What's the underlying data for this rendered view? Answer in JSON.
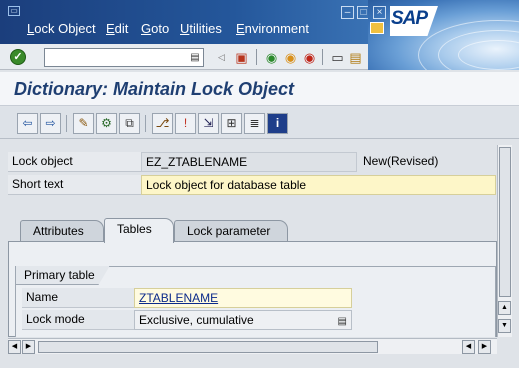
{
  "menubar": {
    "items": [
      "Lock Object",
      "Edit",
      "Goto",
      "Utilities",
      "Environment"
    ]
  },
  "logo": {
    "text": "SAP"
  },
  "toolbar": {
    "command_value": ""
  },
  "title": "Dictionary: Maintain Lock Object",
  "header": {
    "lock_object_label": "Lock object",
    "lock_object_value": "EZ_ZTABLENAME",
    "status": "New(Revised)",
    "short_text_label": "Short text",
    "short_text_value": "Lock object for database table"
  },
  "tabs": [
    {
      "label": "Attributes",
      "active": false
    },
    {
      "label": "Tables",
      "active": true
    },
    {
      "label": "Lock parameter",
      "active": false
    }
  ],
  "primary_table": {
    "group_title": "Primary table",
    "name_label": "Name",
    "name_value": "ZTABLENAME",
    "lock_mode_label": "Lock mode",
    "lock_mode_value": "Exclusive, cumulative"
  },
  "icons": {
    "enter": "check-icon",
    "colors": {
      "accent": "#1f3f72",
      "highlight": "#fdf6c8",
      "input_active": "#fffbe0"
    }
  }
}
